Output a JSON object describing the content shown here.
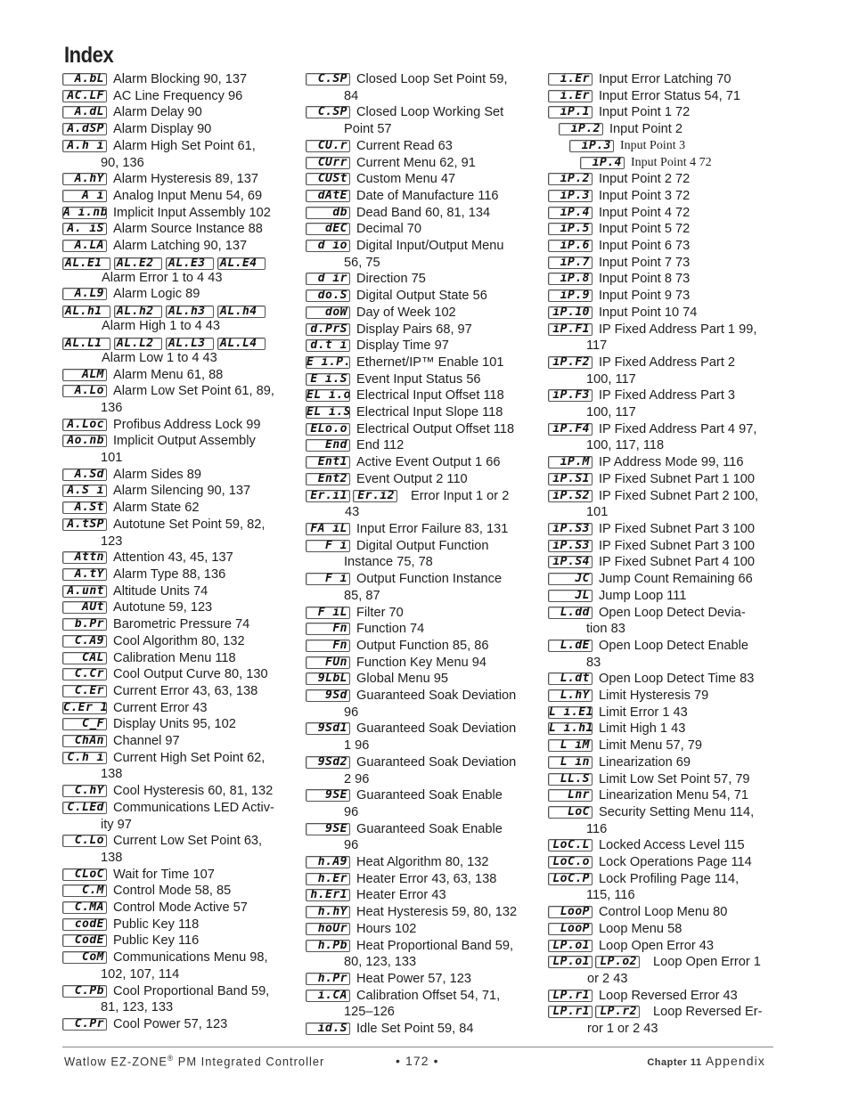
{
  "page": {
    "title": "Index",
    "footer": {
      "product_prefix": "Watlow EZ-ZONE",
      "registered": "®",
      "product_suffix": " PM Integrated Controller",
      "page_number": "• 172 •",
      "chapter_label": "Chapter 11",
      "chapter_title": "Appendix"
    }
  },
  "columns": [
    {
      "entries": [
        {
          "codes": [
            "A.bL"
          ],
          "text": "Alarm Blocking  90, 137"
        },
        {
          "codes": [
            "AC.LF"
          ],
          "text": "AC Line Frequency  96"
        },
        {
          "codes": [
            "A.dL"
          ],
          "text": "Alarm Delay  90"
        },
        {
          "codes": [
            "A.dSP"
          ],
          "text": "Alarm Display  90"
        },
        {
          "codes": [
            "A.h i"
          ],
          "text": "Alarm High Set Point  61,",
          "cont": "90, 136"
        },
        {
          "codes": [
            "A.hY"
          ],
          "text": "Alarm Hysteresis  89, 137"
        },
        {
          "codes": [
            "A i"
          ],
          "text": "Analog Input Menu  54, 69"
        },
        {
          "codes": [
            "A i.nb"
          ],
          "text": "Implicit Input Assembly  102"
        },
        {
          "codes": [
            "A. iS"
          ],
          "text": "Alarm Source Instance  88"
        },
        {
          "codes": [
            "A.LA"
          ],
          "text": "Alarm Latching  90, 137"
        },
        {
          "codes": [
            "AL.E1",
            "AL.E2",
            "AL.E3",
            "AL.E4"
          ],
          "text": "Alarm Error 1 to 4  43",
          "wide": true
        },
        {
          "codes": [
            "A.L9"
          ],
          "text": "Alarm Logic  89"
        },
        {
          "codes": [
            "AL.h1",
            "AL.h2",
            "AL.h3",
            "AL.h4"
          ],
          "text": "Alarm High 1 to 4  43",
          "wide": true
        },
        {
          "codes": [
            "AL.L1",
            "AL.L2",
            "AL.L3",
            "AL.L4"
          ],
          "text": "Alarm Low 1 to 4  43",
          "wide": true
        },
        {
          "codes": [
            "ALM"
          ],
          "text": "Alarm Menu  61, 88"
        },
        {
          "codes": [
            "A.Lo"
          ],
          "text": "Alarm Low Set Point  61, 89,",
          "cont": "136"
        },
        {
          "codes": [
            "A.Loc"
          ],
          "text": "Profibus Address Lock  99"
        },
        {
          "codes": [
            "Ao.nb"
          ],
          "text": "Implicit Output Assembly",
          "cont": "101"
        },
        {
          "codes": [
            "A.Sd"
          ],
          "text": "Alarm Sides  89"
        },
        {
          "codes": [
            "A.S i"
          ],
          "text": "Alarm Silencing  90, 137"
        },
        {
          "codes": [
            "A.St"
          ],
          "text": "Alarm State  62"
        },
        {
          "codes": [
            "A.tSP"
          ],
          "text": "Autotune Set Point  59, 82,",
          "cont": "123"
        },
        {
          "codes": [
            "Attn"
          ],
          "text": "Attention  43, 45, 137"
        },
        {
          "codes": [
            "A.tY"
          ],
          "text": "Alarm Type  88, 136"
        },
        {
          "codes": [
            "A.unt"
          ],
          "text": "Altitude Units  74"
        },
        {
          "codes": [
            "AUt"
          ],
          "text": "Autotune  59, 123"
        },
        {
          "codes": [
            "b.Pr"
          ],
          "text": "Barometric Pressure  74"
        },
        {
          "codes": [
            "C.A9"
          ],
          "text": "Cool Algorithm  80, 132"
        },
        {
          "codes": [
            "CAL"
          ],
          "text": "Calibration Menu  118"
        },
        {
          "codes": [
            "C.Cr"
          ],
          "text": "Cool Output Curve  80, 130"
        },
        {
          "codes": [
            "C.Er"
          ],
          "text": "Current Error  43, 63, 138"
        },
        {
          "codes": [
            "C.Er 1"
          ],
          "text": "Current Error  43"
        },
        {
          "codes": [
            "C_F"
          ],
          "text": "Display Units  95, 102"
        },
        {
          "codes": [
            "ChAn"
          ],
          "text": "Channel  97"
        },
        {
          "codes": [
            "C.h i"
          ],
          "text": "Current High Set Point  62,",
          "cont": "138"
        },
        {
          "codes": [
            "C.hY"
          ],
          "text": "Cool Hysteresis  60, 81, 132"
        },
        {
          "codes": [
            "C.LEd"
          ],
          "text": "Communications LED Activ-",
          "cont": "ity  97"
        },
        {
          "codes": [
            "C.Lo"
          ],
          "text": "Current Low Set Point  63,",
          "cont": "138"
        },
        {
          "codes": [
            "CLoC"
          ],
          "text": "Wait for Time  107"
        },
        {
          "codes": [
            "C.M"
          ],
          "text": "Control Mode  58, 85"
        },
        {
          "codes": [
            "C.MA"
          ],
          "text": "Control Mode Active  57"
        },
        {
          "codes": [
            "codE"
          ],
          "text": "Public Key  118"
        },
        {
          "codes": [
            "CodE"
          ],
          "text": "Public Key  116"
        },
        {
          "codes": [
            "CoM"
          ],
          "text": "Communications Menu  98,",
          "cont": "102, 107, 114"
        },
        {
          "codes": [
            "C.Pb"
          ],
          "text": "Cool Proportional Band  59,",
          "cont": "81, 123, 133"
        },
        {
          "codes": [
            "C.Pr"
          ],
          "text": "Cool Power  57, 123"
        }
      ]
    },
    {
      "entries": [
        {
          "codes": [
            "C.SP"
          ],
          "text": "Closed Loop Set Point  59,",
          "cont": "84"
        },
        {
          "codes": [
            "C.SP"
          ],
          "text": "Closed Loop Working Set",
          "cont": "Point  57"
        },
        {
          "codes": [
            "CU.r"
          ],
          "text": "Current Read  63"
        },
        {
          "codes": [
            "CUrr"
          ],
          "text": "Current Menu  62, 91"
        },
        {
          "codes": [
            "CUSt"
          ],
          "text": "Custom Menu  47"
        },
        {
          "codes": [
            "dAtE"
          ],
          "text": "Date of Manufacture  116"
        },
        {
          "codes": [
            "db"
          ],
          "text": "Dead Band  60, 81, 134"
        },
        {
          "codes": [
            "dEC"
          ],
          "text": "Decimal  70"
        },
        {
          "codes": [
            "d io"
          ],
          "text": "Digital Input/Output Menu",
          "cont": "56, 75"
        },
        {
          "codes": [
            "d ir"
          ],
          "text": "Direction  75"
        },
        {
          "codes": [
            "do.S"
          ],
          "text": "Digital Output State  56"
        },
        {
          "codes": [
            "doW"
          ],
          "text": "Day of Week  102"
        },
        {
          "codes": [
            "d.PrS"
          ],
          "text": "Display Pairs  68, 97"
        },
        {
          "codes": [
            "d.t i"
          ],
          "text": "Display Time  97"
        },
        {
          "codes": [
            "E i.P.E"
          ],
          "text": "Ethernet/IP™ Enable  101"
        },
        {
          "codes": [
            "E i.S"
          ],
          "text": "Event Input Status  56"
        },
        {
          "codes": [
            "EL i.o"
          ],
          "text": "Electrical Input Offset  118"
        },
        {
          "codes": [
            "EL i.S"
          ],
          "text": "Electrical Input Slope  118"
        },
        {
          "codes": [
            "ELo.o"
          ],
          "text": "Electrical Output Offset  118"
        },
        {
          "codes": [
            "End"
          ],
          "text": "End  112"
        },
        {
          "codes": [
            "Ent1"
          ],
          "text": "Active Event Output 1  66"
        },
        {
          "codes": [
            "Ent2"
          ],
          "text": "Event Output 2  110"
        },
        {
          "codes": [
            "Er.i1",
            "Er.i2"
          ],
          "text": "Error Input 1 or 2",
          "cont": "43",
          "double": true
        },
        {
          "codes": [
            "FA iL"
          ],
          "text": "Input Error Failure  83, 131"
        },
        {
          "codes": [
            "F i"
          ],
          "text": "Digital Output Function",
          "cont": "Instance  75, 78"
        },
        {
          "codes": [
            "F i"
          ],
          "text": "Output Function Instance",
          "cont": "85, 87"
        },
        {
          "codes": [
            "F iL"
          ],
          "text": "Filter  70"
        },
        {
          "codes": [
            "Fn"
          ],
          "text": "Function  74"
        },
        {
          "codes": [
            "Fn"
          ],
          "text": "Output Function  85, 86"
        },
        {
          "codes": [
            "FUn"
          ],
          "text": "Function Key Menu  94"
        },
        {
          "codes": [
            "9LbL"
          ],
          "text": "Global Menu  95"
        },
        {
          "codes": [
            "9Sd"
          ],
          "text": "Guaranteed Soak Deviation",
          "cont": "96"
        },
        {
          "codes": [
            "9Sd1"
          ],
          "text": "Guaranteed Soak Deviation",
          "cont": "1  96"
        },
        {
          "codes": [
            "9Sd2"
          ],
          "text": "Guaranteed Soak Deviation",
          "cont": "2  96"
        },
        {
          "codes": [
            "9SE"
          ],
          "text": "Guaranteed Soak Enable",
          "cont": "96"
        },
        {
          "codes": [
            "9SE"
          ],
          "text": "Guaranteed Soak Enable",
          "cont": "96"
        },
        {
          "codes": [
            "h.A9"
          ],
          "text": "Heat Algorithm  80, 132"
        },
        {
          "codes": [
            "h.Er"
          ],
          "text": "Heater Error  43, 63, 138"
        },
        {
          "codes": [
            "h.Er1"
          ],
          "text": "Heater Error  43"
        },
        {
          "codes": [
            "h.hY"
          ],
          "text": "Heat Hysteresis  59, 80, 132"
        },
        {
          "codes": [
            "hoUr"
          ],
          "text": "Hours  102"
        },
        {
          "codes": [
            "h.Pb"
          ],
          "text": "Heat Proportional Band  59,",
          "cont": "80, 123, 133"
        },
        {
          "codes": [
            "h.Pr"
          ],
          "text": "Heat Power  57, 123"
        },
        {
          "codes": [
            "i.CA"
          ],
          "text": "Calibration Offset  54, 71,",
          "cont": "125–126"
        },
        {
          "codes": [
            "id.S"
          ],
          "text": "Idle Set Point  59, 84"
        }
      ]
    },
    {
      "entries": [
        {
          "codes": [
            "i.Er"
          ],
          "text": "Input Error Latching  70"
        },
        {
          "codes": [
            "i.Er"
          ],
          "text": "Input Error Status  54, 71"
        },
        {
          "codes": [
            "iP.1"
          ],
          "text": "Input Point 1  72"
        },
        {
          "codes": [
            "iP.2"
          ],
          "text": "Input Point 2",
          "indent": 1
        },
        {
          "codes": [
            "iP.3"
          ],
          "text": "Input Point 3",
          "indent": 2
        },
        {
          "codes": [
            "iP.4"
          ],
          "text": "Input Point 4  72",
          "indent": 3
        },
        {
          "codes": [
            "iP.2"
          ],
          "text": "Input Point 2  72"
        },
        {
          "codes": [
            "iP.3"
          ],
          "text": "Input Point 3  72"
        },
        {
          "codes": [
            "iP.4"
          ],
          "text": "Input Point 4  72"
        },
        {
          "codes": [
            "iP.5"
          ],
          "text": "Input Point 5  72"
        },
        {
          "codes": [
            "iP.6"
          ],
          "text": "Input Point 6  73"
        },
        {
          "codes": [
            "iP.7"
          ],
          "text": "Input Point 7  73"
        },
        {
          "codes": [
            "iP.8"
          ],
          "text": "Input Point 8  73"
        },
        {
          "codes": [
            "iP.9"
          ],
          "text": "Input Point 9  73"
        },
        {
          "codes": [
            "iP.10"
          ],
          "text": "Input Point 10  74"
        },
        {
          "codes": [
            "iP.F1"
          ],
          "text": "IP Fixed Address Part 1  99,",
          "cont": "117"
        },
        {
          "codes": [
            "iP.F2"
          ],
          "text": "IP Fixed Address Part 2",
          "cont": "100, 117"
        },
        {
          "codes": [
            "iP.F3"
          ],
          "text": "IP Fixed Address Part 3",
          "cont": "100, 117"
        },
        {
          "codes": [
            "iP.F4"
          ],
          "text": "IP Fixed Address Part 4  97,",
          "cont": "100, 117, 118"
        },
        {
          "codes": [
            "iP.M"
          ],
          "text": "IP Address Mode  99, 116"
        },
        {
          "codes": [
            "iP.S1"
          ],
          "text": "IP Fixed Subnet Part 1  100"
        },
        {
          "codes": [
            "iP.S2"
          ],
          "text": "IP Fixed Subnet Part 2  100,",
          "cont": "101"
        },
        {
          "codes": [
            "iP.S3"
          ],
          "text": "IP Fixed Subnet Part 3  100"
        },
        {
          "codes": [
            "iP.S3"
          ],
          "text": "IP Fixed Subnet Part 3  100"
        },
        {
          "codes": [
            "iP.S4"
          ],
          "text": "IP Fixed Subnet Part 4  100"
        },
        {
          "codes": [
            "JC"
          ],
          "text": "Jump Count Remaining  66"
        },
        {
          "codes": [
            "JL"
          ],
          "text": "Jump Loop  111"
        },
        {
          "codes": [
            "L.dd"
          ],
          "text": "Open Loop Detect Devia-",
          "cont": "tion  83"
        },
        {
          "codes": [
            "L.dE"
          ],
          "text": "Open Loop Detect Enable",
          "cont": "83"
        },
        {
          "codes": [
            "L.dt"
          ],
          "text": "Open Loop Detect Time  83"
        },
        {
          "codes": [
            "L.hY"
          ],
          "text": "Limit Hysteresis  79"
        },
        {
          "codes": [
            "L i.E1"
          ],
          "text": "Limit Error 1  43"
        },
        {
          "codes": [
            "L i.h1"
          ],
          "text": "Limit High 1  43"
        },
        {
          "codes": [
            "L iM"
          ],
          "text": "Limit Menu  57, 79"
        },
        {
          "codes": [
            "L in"
          ],
          "text": "Linearization  69"
        },
        {
          "codes": [
            "LL.S"
          ],
          "text": "Limit Low Set Point  57, 79"
        },
        {
          "codes": [
            "Lnr"
          ],
          "text": "Linearization Menu  54, 71"
        },
        {
          "codes": [
            "LoC"
          ],
          "text": "Security Setting Menu  114,",
          "cont": "116"
        },
        {
          "codes": [
            "LoC.L"
          ],
          "text": "Locked Access Level  115"
        },
        {
          "codes": [
            "LoC.o"
          ],
          "text": "Lock Operations Page  114"
        },
        {
          "codes": [
            "LoC.P"
          ],
          "text": "Lock Profiling Page  114,",
          "cont": "115, 116"
        },
        {
          "codes": [
            "LooP"
          ],
          "text": "Control Loop Menu  80"
        },
        {
          "codes": [
            "LooP"
          ],
          "text": "Loop Menu  58"
        },
        {
          "codes": [
            "LP.o1"
          ],
          "text": "Loop Open Error  43"
        },
        {
          "codes": [
            "LP.o1",
            "LP.o2"
          ],
          "text": "Loop Open Error 1",
          "cont": "or 2  43",
          "double": true
        },
        {
          "codes": [
            "LP.r1"
          ],
          "text": "Loop Reversed Error  43"
        },
        {
          "codes": [
            "LP.r1",
            "LP.r2"
          ],
          "text": "Loop Reversed Er-",
          "cont": "ror 1 or 2  43",
          "double": true
        }
      ]
    }
  ]
}
